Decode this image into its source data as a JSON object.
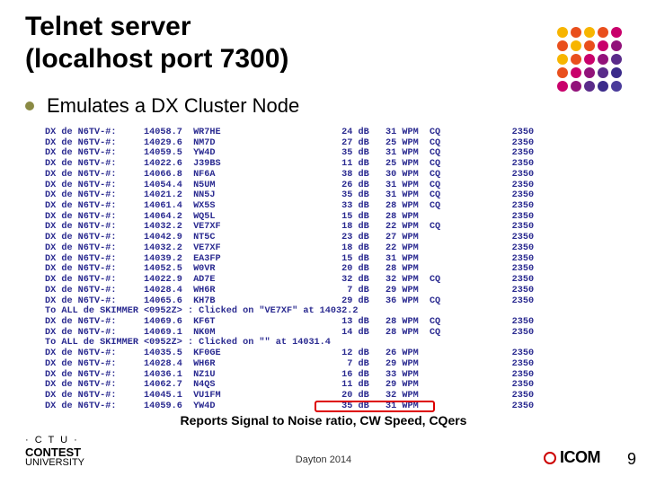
{
  "title_line1": "Telnet server",
  "title_line2": "(localhost port 7300)",
  "bullet": "Emulates a DX Cluster Node",
  "caption": "Reports Signal to Noise ratio, CW Speed, CQers",
  "footer_date": "Dayton 2014",
  "page_number": "9",
  "contest_u": {
    "line1": "· C T U ·",
    "line2": "CONTEST",
    "line3": "UNIVERSITY"
  },
  "icom_text": "ICOM",
  "dot_colors": [
    "#f7b500",
    "#e94f1d",
    "#f7b500",
    "#e94f1d",
    "#c9006b",
    "#e94f1d",
    "#f7b500",
    "#e94f1d",
    "#c9006b",
    "#92127a",
    "#f7b500",
    "#e94f1d",
    "#c9006b",
    "#92127a",
    "#5a2b8a",
    "#e94f1d",
    "#c9006b",
    "#92127a",
    "#5a2b8a",
    "#3b2b8a",
    "#c9006b",
    "#92127a",
    "#5a2b8a",
    "#3b2b8a",
    "#4a3b9a"
  ],
  "rows": [
    {
      "p": "DX de N6TV-#:",
      "f": "14058.7",
      "c": "WR7HE",
      "d": "24 dB",
      "w": "31 WPM",
      "q": "CQ",
      "t": "2350"
    },
    {
      "p": "DX de N6TV-#:",
      "f": "14029.6",
      "c": "NM7D",
      "d": "27 dB",
      "w": "25 WPM",
      "q": "CQ",
      "t": "2350"
    },
    {
      "p": "DX de N6TV-#:",
      "f": "14059.5",
      "c": "YW4D",
      "d": "35 dB",
      "w": "31 WPM",
      "q": "CQ",
      "t": "2350"
    },
    {
      "p": "DX de N6TV-#:",
      "f": "14022.6",
      "c": "J39BS",
      "d": "11 dB",
      "w": "25 WPM",
      "q": "CQ",
      "t": "2350"
    },
    {
      "p": "DX de N6TV-#:",
      "f": "14066.8",
      "c": "NF6A",
      "d": "38 dB",
      "w": "30 WPM",
      "q": "CQ",
      "t": "2350"
    },
    {
      "p": "DX de N6TV-#:",
      "f": "14054.4",
      "c": "N5UM",
      "d": "26 dB",
      "w": "31 WPM",
      "q": "CQ",
      "t": "2350"
    },
    {
      "p": "DX de N6TV-#:",
      "f": "14021.2",
      "c": "NN5J",
      "d": "35 dB",
      "w": "31 WPM",
      "q": "CQ",
      "t": "2350"
    },
    {
      "p": "DX de N6TV-#:",
      "f": "14061.4",
      "c": "WX5S",
      "d": "33 dB",
      "w": "28 WPM",
      "q": "CQ",
      "t": "2350"
    },
    {
      "p": "DX de N6TV-#:",
      "f": "14064.2",
      "c": "WQ5L",
      "d": "15 dB",
      "w": "28 WPM",
      "q": "",
      "t": "2350"
    },
    {
      "p": "DX de N6TV-#:",
      "f": "14032.2",
      "c": "VE7XF",
      "d": "18 dB",
      "w": "22 WPM",
      "q": "CQ",
      "t": "2350"
    },
    {
      "p": "DX de N6TV-#:",
      "f": "14042.9",
      "c": "NT5C",
      "d": "23 dB",
      "w": "27 WPM",
      "q": "",
      "t": "2350"
    },
    {
      "p": "DX de N6TV-#:",
      "f": "14032.2",
      "c": "VE7XF",
      "d": "18 dB",
      "w": "22 WPM",
      "q": "",
      "t": "2350"
    },
    {
      "p": "DX de N6TV-#:",
      "f": "14039.2",
      "c": "EA3FP",
      "d": "15 dB",
      "w": "31 WPM",
      "q": "",
      "t": "2350"
    },
    {
      "p": "DX de N6TV-#:",
      "f": "14052.5",
      "c": "W0VR",
      "d": "20 dB",
      "w": "28 WPM",
      "q": "",
      "t": "2350"
    },
    {
      "p": "DX de N6TV-#:",
      "f": "14022.9",
      "c": "AD7E",
      "d": "32 dB",
      "w": "32 WPM",
      "q": "CQ",
      "t": "2350"
    },
    {
      "p": "DX de N6TV-#:",
      "f": "14028.4",
      "c": "WH6R",
      "d": "7 dB",
      "w": "29 WPM",
      "q": "",
      "t": "2350"
    },
    {
      "p": "DX de N6TV-#:",
      "f": "14065.6",
      "c": "KH7B",
      "d": "29 dB",
      "w": "36 WPM",
      "q": "CQ",
      "t": "2350"
    },
    {
      "raw": "To ALL de SKIMMER <0952Z> : Clicked on \"VE7XF\" at 14032.2"
    },
    {
      "p": "DX de N6TV-#:",
      "f": "14069.6",
      "c": "KF6T",
      "d": "13 dB",
      "w": "28 WPM",
      "q": "CQ",
      "t": "2350"
    },
    {
      "p": "DX de N6TV-#:",
      "f": "14069.1",
      "c": "NK0M",
      "d": "14 dB",
      "w": "28 WPM",
      "q": "CQ",
      "t": "2350"
    },
    {
      "raw": "To ALL de SKIMMER <0952Z> : Clicked on \"\" at 14031.4"
    },
    {
      "p": "DX de N6TV-#:",
      "f": "14035.5",
      "c": "KF0GE",
      "d": "12 dB",
      "w": "26 WPM",
      "q": "",
      "t": "2350"
    },
    {
      "p": "DX de N6TV-#:",
      "f": "14028.4",
      "c": "WH6R",
      "d": "7 dB",
      "w": "29 WPM",
      "q": "",
      "t": "2350"
    },
    {
      "p": "DX de N6TV-#:",
      "f": "14036.1",
      "c": "NZ1U",
      "d": "16 dB",
      "w": "33 WPM",
      "q": "",
      "t": "2350"
    },
    {
      "p": "DX de N6TV-#:",
      "f": "14062.7",
      "c": "N4QS",
      "d": "11 dB",
      "w": "29 WPM",
      "q": "",
      "t": "2350"
    },
    {
      "p": "DX de N6TV-#:",
      "f": "14045.1",
      "c": "VU1FM",
      "d": "20 dB",
      "w": "32 WPM",
      "q": "",
      "t": "2350"
    },
    {
      "p": "DX de N6TV-#:",
      "f": "14059.6",
      "c": "YW4D",
      "d": "35 dB",
      "w": "31 WPM",
      "q": "",
      "t": "2350"
    }
  ],
  "highlight": {
    "row_index": 26
  }
}
